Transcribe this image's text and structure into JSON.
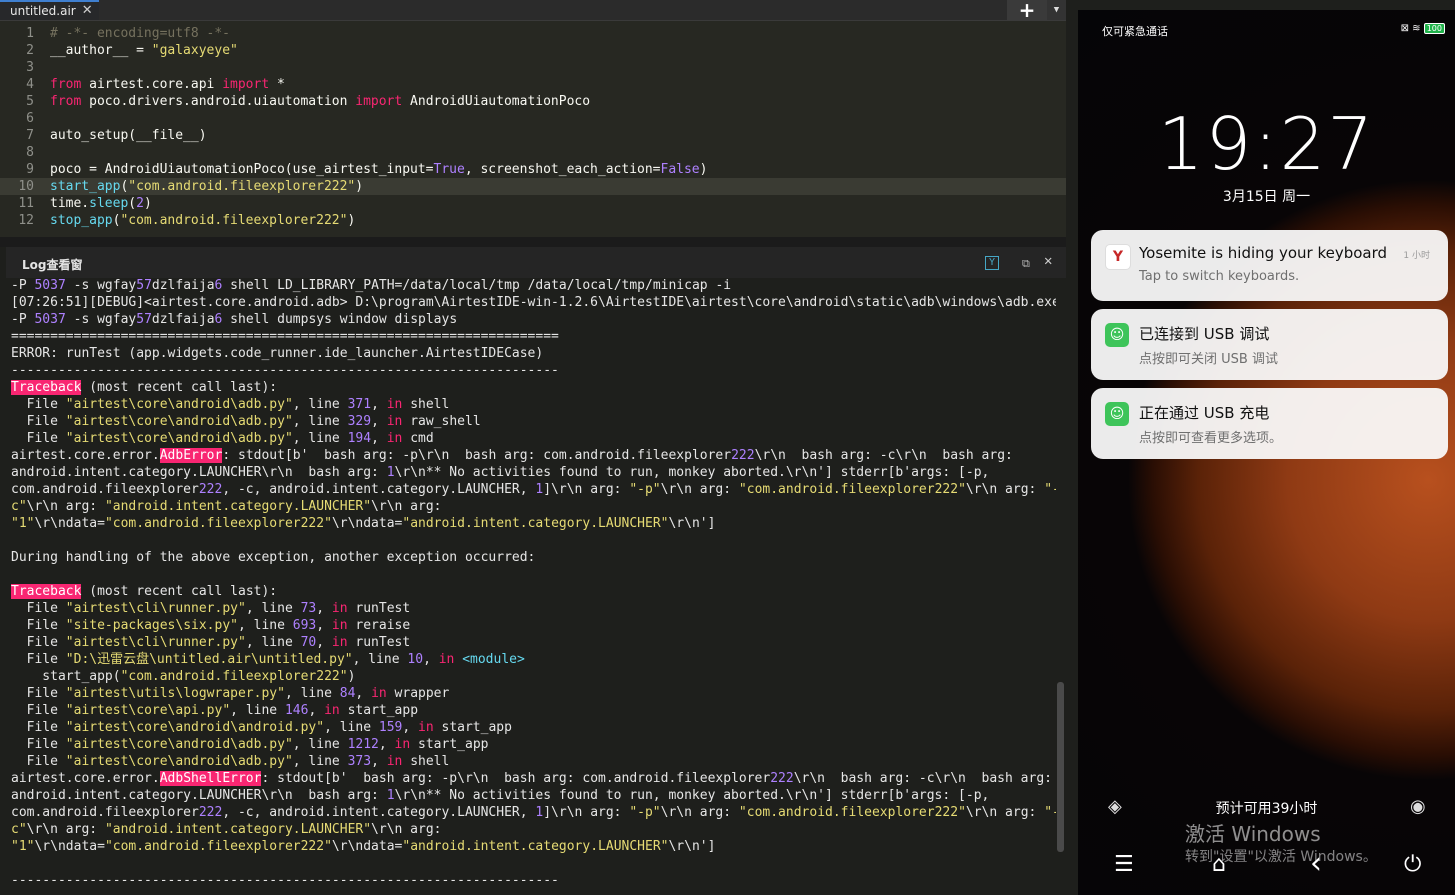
{
  "editor": {
    "tab_label": "untitled.air",
    "tab_close": "✕",
    "add_label": "+",
    "dropdown_label": "▼",
    "lines": [
      {
        "n": "1",
        "segs": [
          {
            "t": "# -*- encoding=utf8 -*-",
            "c": "cm"
          }
        ]
      },
      {
        "n": "2",
        "segs": [
          {
            "t": "__author__ = ",
            "c": ""
          },
          {
            "t": "\"galaxyeye\"",
            "c": "st"
          }
        ]
      },
      {
        "n": "3",
        "segs": []
      },
      {
        "n": "4",
        "segs": [
          {
            "t": "from",
            "c": "kw"
          },
          {
            "t": " airtest.core.api ",
            "c": ""
          },
          {
            "t": "import",
            "c": "kw"
          },
          {
            "t": " *",
            "c": ""
          }
        ]
      },
      {
        "n": "5",
        "segs": [
          {
            "t": "from",
            "c": "kw"
          },
          {
            "t": " poco.drivers.android.uiautomation ",
            "c": ""
          },
          {
            "t": "import",
            "c": "kw"
          },
          {
            "t": " AndroidUiautomationPoco",
            "c": ""
          }
        ]
      },
      {
        "n": "6",
        "segs": []
      },
      {
        "n": "7",
        "segs": [
          {
            "t": "auto_setup(__file__)",
            "c": ""
          }
        ]
      },
      {
        "n": "8",
        "segs": []
      },
      {
        "n": "9",
        "segs": [
          {
            "t": "poco = AndroidUiautomationPoco(use_airtest_input=",
            "c": ""
          },
          {
            "t": "True",
            "c": "bi"
          },
          {
            "t": ", screenshot_each_action=",
            "c": ""
          },
          {
            "t": "False",
            "c": "bi"
          },
          {
            "t": ")",
            "c": ""
          }
        ]
      },
      {
        "n": "10",
        "cur": true,
        "segs": [
          {
            "t": "start_app",
            "c": "fn"
          },
          {
            "t": "(",
            "c": ""
          },
          {
            "t": "\"com.android.fileexplorer222\"",
            "c": "st"
          },
          {
            "t": ")",
            "c": ""
          }
        ]
      },
      {
        "n": "11",
        "segs": [
          {
            "t": "time.",
            "c": ""
          },
          {
            "t": "sleep",
            "c": "fn"
          },
          {
            "t": "(",
            "c": ""
          },
          {
            "t": "2",
            "c": "bi"
          },
          {
            "t": ")",
            "c": ""
          }
        ]
      },
      {
        "n": "12",
        "segs": [
          {
            "t": "stop_app",
            "c": "fn"
          },
          {
            "t": "(",
            "c": ""
          },
          {
            "t": "\"com.android.fileexplorer222\"",
            "c": "st"
          },
          {
            "t": ")",
            "c": ""
          }
        ]
      }
    ]
  },
  "log": {
    "title": "Log查看窗",
    "filter_icon": "Y",
    "restore_icon": "⧉",
    "close_icon": "✕",
    "lines": [
      [
        {
          "t": "-P "
        },
        {
          "t": "5037",
          "c": "n"
        },
        {
          "t": " -s wgfay"
        },
        {
          "t": "57",
          "c": "n"
        },
        {
          "t": "dzlfaija"
        },
        {
          "t": "6",
          "c": "n"
        },
        {
          "t": " shell LD_LIBRARY_PATH=/data/local/tmp /data/local/tmp/minicap -i"
        }
      ],
      [
        {
          "t": "[07:26:51][DEBUG]<airtest.core.android.adb> D:\\program\\AirtestIDE-win-1.2.6\\AirtestIDE\\airtest\\core\\android\\static\\adb\\windows\\adb.exe"
        }
      ],
      [
        {
          "t": "-P "
        },
        {
          "t": "5037",
          "c": "n"
        },
        {
          "t": " -s wgfay"
        },
        {
          "t": "57",
          "c": "n"
        },
        {
          "t": "dzlfaija"
        },
        {
          "t": "6",
          "c": "n"
        },
        {
          "t": " shell dumpsys window displays"
        }
      ],
      [
        {
          "t": "======================================================================"
        }
      ],
      [
        {
          "t": "ERROR: runTest (app.widgets.code_runner.ide_launcher.AirtestIDECase)"
        }
      ],
      [
        {
          "t": "----------------------------------------------------------------------"
        }
      ],
      [
        {
          "t": "Traceback",
          "c": "hl"
        },
        {
          "t": " (most recent call last):"
        }
      ],
      [
        {
          "t": "  File "
        },
        {
          "t": "\"airtest\\core\\android\\adb.py\"",
          "c": "q"
        },
        {
          "t": ", line "
        },
        {
          "t": "371",
          "c": "n"
        },
        {
          "t": ", "
        },
        {
          "t": "in",
          "c": "k"
        },
        {
          "t": " shell"
        }
      ],
      [
        {
          "t": "  File "
        },
        {
          "t": "\"airtest\\core\\android\\adb.py\"",
          "c": "q"
        },
        {
          "t": ", line "
        },
        {
          "t": "329",
          "c": "n"
        },
        {
          "t": ", "
        },
        {
          "t": "in",
          "c": "k"
        },
        {
          "t": " raw_shell"
        }
      ],
      [
        {
          "t": "  File "
        },
        {
          "t": "\"airtest\\core\\android\\adb.py\"",
          "c": "q"
        },
        {
          "t": ", line "
        },
        {
          "t": "194",
          "c": "n"
        },
        {
          "t": ", "
        },
        {
          "t": "in",
          "c": "k"
        },
        {
          "t": " cmd"
        }
      ],
      [
        {
          "t": "airtest.core.error."
        },
        {
          "t": "AdbError",
          "c": "hl"
        },
        {
          "t": ": stdout[b'  bash arg: -p\\r\\n  bash arg: com.android.fileexplorer"
        },
        {
          "t": "222",
          "c": "n"
        },
        {
          "t": "\\r\\n  bash arg: -c\\r\\n  bash arg:"
        }
      ],
      [
        {
          "t": "android.intent.category.LAUNCHER\\r\\n  bash arg: "
        },
        {
          "t": "1",
          "c": "n"
        },
        {
          "t": "\\r\\n** No activities found to run, monkey aborted.\\r\\n'] stderr[b'args: [-p,"
        }
      ],
      [
        {
          "t": "com.android.fileexplorer"
        },
        {
          "t": "222",
          "c": "n"
        },
        {
          "t": ", -c, android.intent.category.LAUNCHER, "
        },
        {
          "t": "1",
          "c": "n"
        },
        {
          "t": "]\\r\\n arg: "
        },
        {
          "t": "\"-p\"",
          "c": "q"
        },
        {
          "t": "\\r\\n arg: "
        },
        {
          "t": "\"com.android.fileexplorer222\"",
          "c": "q"
        },
        {
          "t": "\\r\\n arg: "
        },
        {
          "t": "\"-",
          "c": "q"
        }
      ],
      [
        {
          "t": "c\"",
          "c": "q"
        },
        {
          "t": "\\r\\n arg: "
        },
        {
          "t": "\"android.intent.category.LAUNCHER\"",
          "c": "q"
        },
        {
          "t": "\\r\\n arg:"
        }
      ],
      [
        {
          "t": "\"1\"",
          "c": "q"
        },
        {
          "t": "\\r\\ndata="
        },
        {
          "t": "\"com.android.fileexplorer222\"",
          "c": "q"
        },
        {
          "t": "\\r\\ndata="
        },
        {
          "t": "\"android.intent.category.LAUNCHER\"",
          "c": "q"
        },
        {
          "t": "\\r\\n']"
        }
      ],
      [],
      [
        {
          "t": "During handling of the above exception, another exception occurred:"
        }
      ],
      [],
      [
        {
          "t": "Traceback",
          "c": "hl"
        },
        {
          "t": " (most recent call last):"
        }
      ],
      [
        {
          "t": "  File "
        },
        {
          "t": "\"airtest\\cli\\runner.py\"",
          "c": "q"
        },
        {
          "t": ", line "
        },
        {
          "t": "73",
          "c": "n"
        },
        {
          "t": ", "
        },
        {
          "t": "in",
          "c": "k"
        },
        {
          "t": " runTest"
        }
      ],
      [
        {
          "t": "  File "
        },
        {
          "t": "\"site-packages\\six.py\"",
          "c": "q"
        },
        {
          "t": ", line "
        },
        {
          "t": "693",
          "c": "n"
        },
        {
          "t": ", "
        },
        {
          "t": "in",
          "c": "k"
        },
        {
          "t": " reraise"
        }
      ],
      [
        {
          "t": "  File "
        },
        {
          "t": "\"airtest\\cli\\runner.py\"",
          "c": "q"
        },
        {
          "t": ", line "
        },
        {
          "t": "70",
          "c": "n"
        },
        {
          "t": ", "
        },
        {
          "t": "in",
          "c": "k"
        },
        {
          "t": " runTest"
        }
      ],
      [
        {
          "t": "  File "
        },
        {
          "t": "\"D:\\迅雷云盘\\untitled.air\\untitled.py\"",
          "c": "q"
        },
        {
          "t": ", line "
        },
        {
          "t": "10",
          "c": "n"
        },
        {
          "t": ", "
        },
        {
          "t": "in",
          "c": "k"
        },
        {
          "t": " "
        },
        {
          "t": "<module>",
          "c": "f"
        }
      ],
      [
        {
          "t": "    start_app("
        },
        {
          "t": "\"com.android.fileexplorer222\"",
          "c": "q"
        },
        {
          "t": ")"
        }
      ],
      [
        {
          "t": "  File "
        },
        {
          "t": "\"airtest\\utils\\logwraper.py\"",
          "c": "q"
        },
        {
          "t": ", line "
        },
        {
          "t": "84",
          "c": "n"
        },
        {
          "t": ", "
        },
        {
          "t": "in",
          "c": "k"
        },
        {
          "t": " wrapper"
        }
      ],
      [
        {
          "t": "  File "
        },
        {
          "t": "\"airtest\\core\\api.py\"",
          "c": "q"
        },
        {
          "t": ", line "
        },
        {
          "t": "146",
          "c": "n"
        },
        {
          "t": ", "
        },
        {
          "t": "in",
          "c": "k"
        },
        {
          "t": " start_app"
        }
      ],
      [
        {
          "t": "  File "
        },
        {
          "t": "\"airtest\\core\\android\\android.py\"",
          "c": "q"
        },
        {
          "t": ", line "
        },
        {
          "t": "159",
          "c": "n"
        },
        {
          "t": ", "
        },
        {
          "t": "in",
          "c": "k"
        },
        {
          "t": " start_app"
        }
      ],
      [
        {
          "t": "  File "
        },
        {
          "t": "\"airtest\\core\\android\\adb.py\"",
          "c": "q"
        },
        {
          "t": ", line "
        },
        {
          "t": "1212",
          "c": "n"
        },
        {
          "t": ", "
        },
        {
          "t": "in",
          "c": "k"
        },
        {
          "t": " start_app"
        }
      ],
      [
        {
          "t": "  File "
        },
        {
          "t": "\"airtest\\core\\android\\adb.py\"",
          "c": "q"
        },
        {
          "t": ", line "
        },
        {
          "t": "373",
          "c": "n"
        },
        {
          "t": ", "
        },
        {
          "t": "in",
          "c": "k"
        },
        {
          "t": " shell"
        }
      ],
      [
        {
          "t": "airtest.core.error."
        },
        {
          "t": "AdbShellError",
          "c": "hl"
        },
        {
          "t": ": stdout[b'  bash arg: -p\\r\\n  bash arg: com.android.fileexplorer"
        },
        {
          "t": "222",
          "c": "n"
        },
        {
          "t": "\\r\\n  bash arg: -c\\r\\n  bash arg:"
        }
      ],
      [
        {
          "t": "android.intent.category.LAUNCHER\\r\\n  bash arg: "
        },
        {
          "t": "1",
          "c": "n"
        },
        {
          "t": "\\r\\n** No activities found to run, monkey aborted.\\r\\n'] stderr[b'args: [-p,"
        }
      ],
      [
        {
          "t": "com.android.fileexplorer"
        },
        {
          "t": "222",
          "c": "n"
        },
        {
          "t": ", -c, android.intent.category.LAUNCHER, "
        },
        {
          "t": "1",
          "c": "n"
        },
        {
          "t": "]\\r\\n arg: "
        },
        {
          "t": "\"-p\"",
          "c": "q"
        },
        {
          "t": "\\r\\n arg: "
        },
        {
          "t": "\"com.android.fileexplorer222\"",
          "c": "q"
        },
        {
          "t": "\\r\\n arg: "
        },
        {
          "t": "\"-",
          "c": "q"
        }
      ],
      [
        {
          "t": "c\"",
          "c": "q"
        },
        {
          "t": "\\r\\n arg: "
        },
        {
          "t": "\"android.intent.category.LAUNCHER\"",
          "c": "q"
        },
        {
          "t": "\\r\\n arg:"
        }
      ],
      [
        {
          "t": "\"1\"",
          "c": "q"
        },
        {
          "t": "\\r\\ndata="
        },
        {
          "t": "\"com.android.fileexplorer222\"",
          "c": "q"
        },
        {
          "t": "\\r\\ndata="
        },
        {
          "t": "\"android.intent.category.LAUNCHER\"",
          "c": "q"
        },
        {
          "t": "\\r\\n']"
        }
      ],
      [],
      [
        {
          "t": "----------------------------------------------------------------------"
        }
      ]
    ]
  },
  "phone": {
    "status_left": "仅可紧急通话",
    "status_icons": "⊠ ≋",
    "battery": "100",
    "time": "19:27",
    "date": "3月15日 周一",
    "notifications": [
      {
        "icon": "Y",
        "title": "Yosemite is hiding your keyboard",
        "sub": "Tap to switch keyboards.",
        "time": "1 小时"
      },
      {
        "icon": "☺",
        "title": "已连接到 USB 调试",
        "sub": "点按即可关闭 USB 调试",
        "time": ""
      },
      {
        "icon": "☺",
        "title": "正在通过 USB 充电",
        "sub": "点按即可查看更多选项。",
        "time": ""
      }
    ],
    "bottom_text": "预计可用39小时",
    "watermark_title": "激活 Windows",
    "watermark_sub": "转到\"设置\"以激活 Windows。",
    "nav_icons": {
      "menu": "☰",
      "home": "⌂",
      "back": "‹",
      "power": "⏻"
    },
    "lock_icons": {
      "shield": "◈",
      "camera": "◉"
    },
    "colors": {
      "usb_icon": "#3ec45a",
      "yosemite_icon": "#c62828"
    }
  }
}
